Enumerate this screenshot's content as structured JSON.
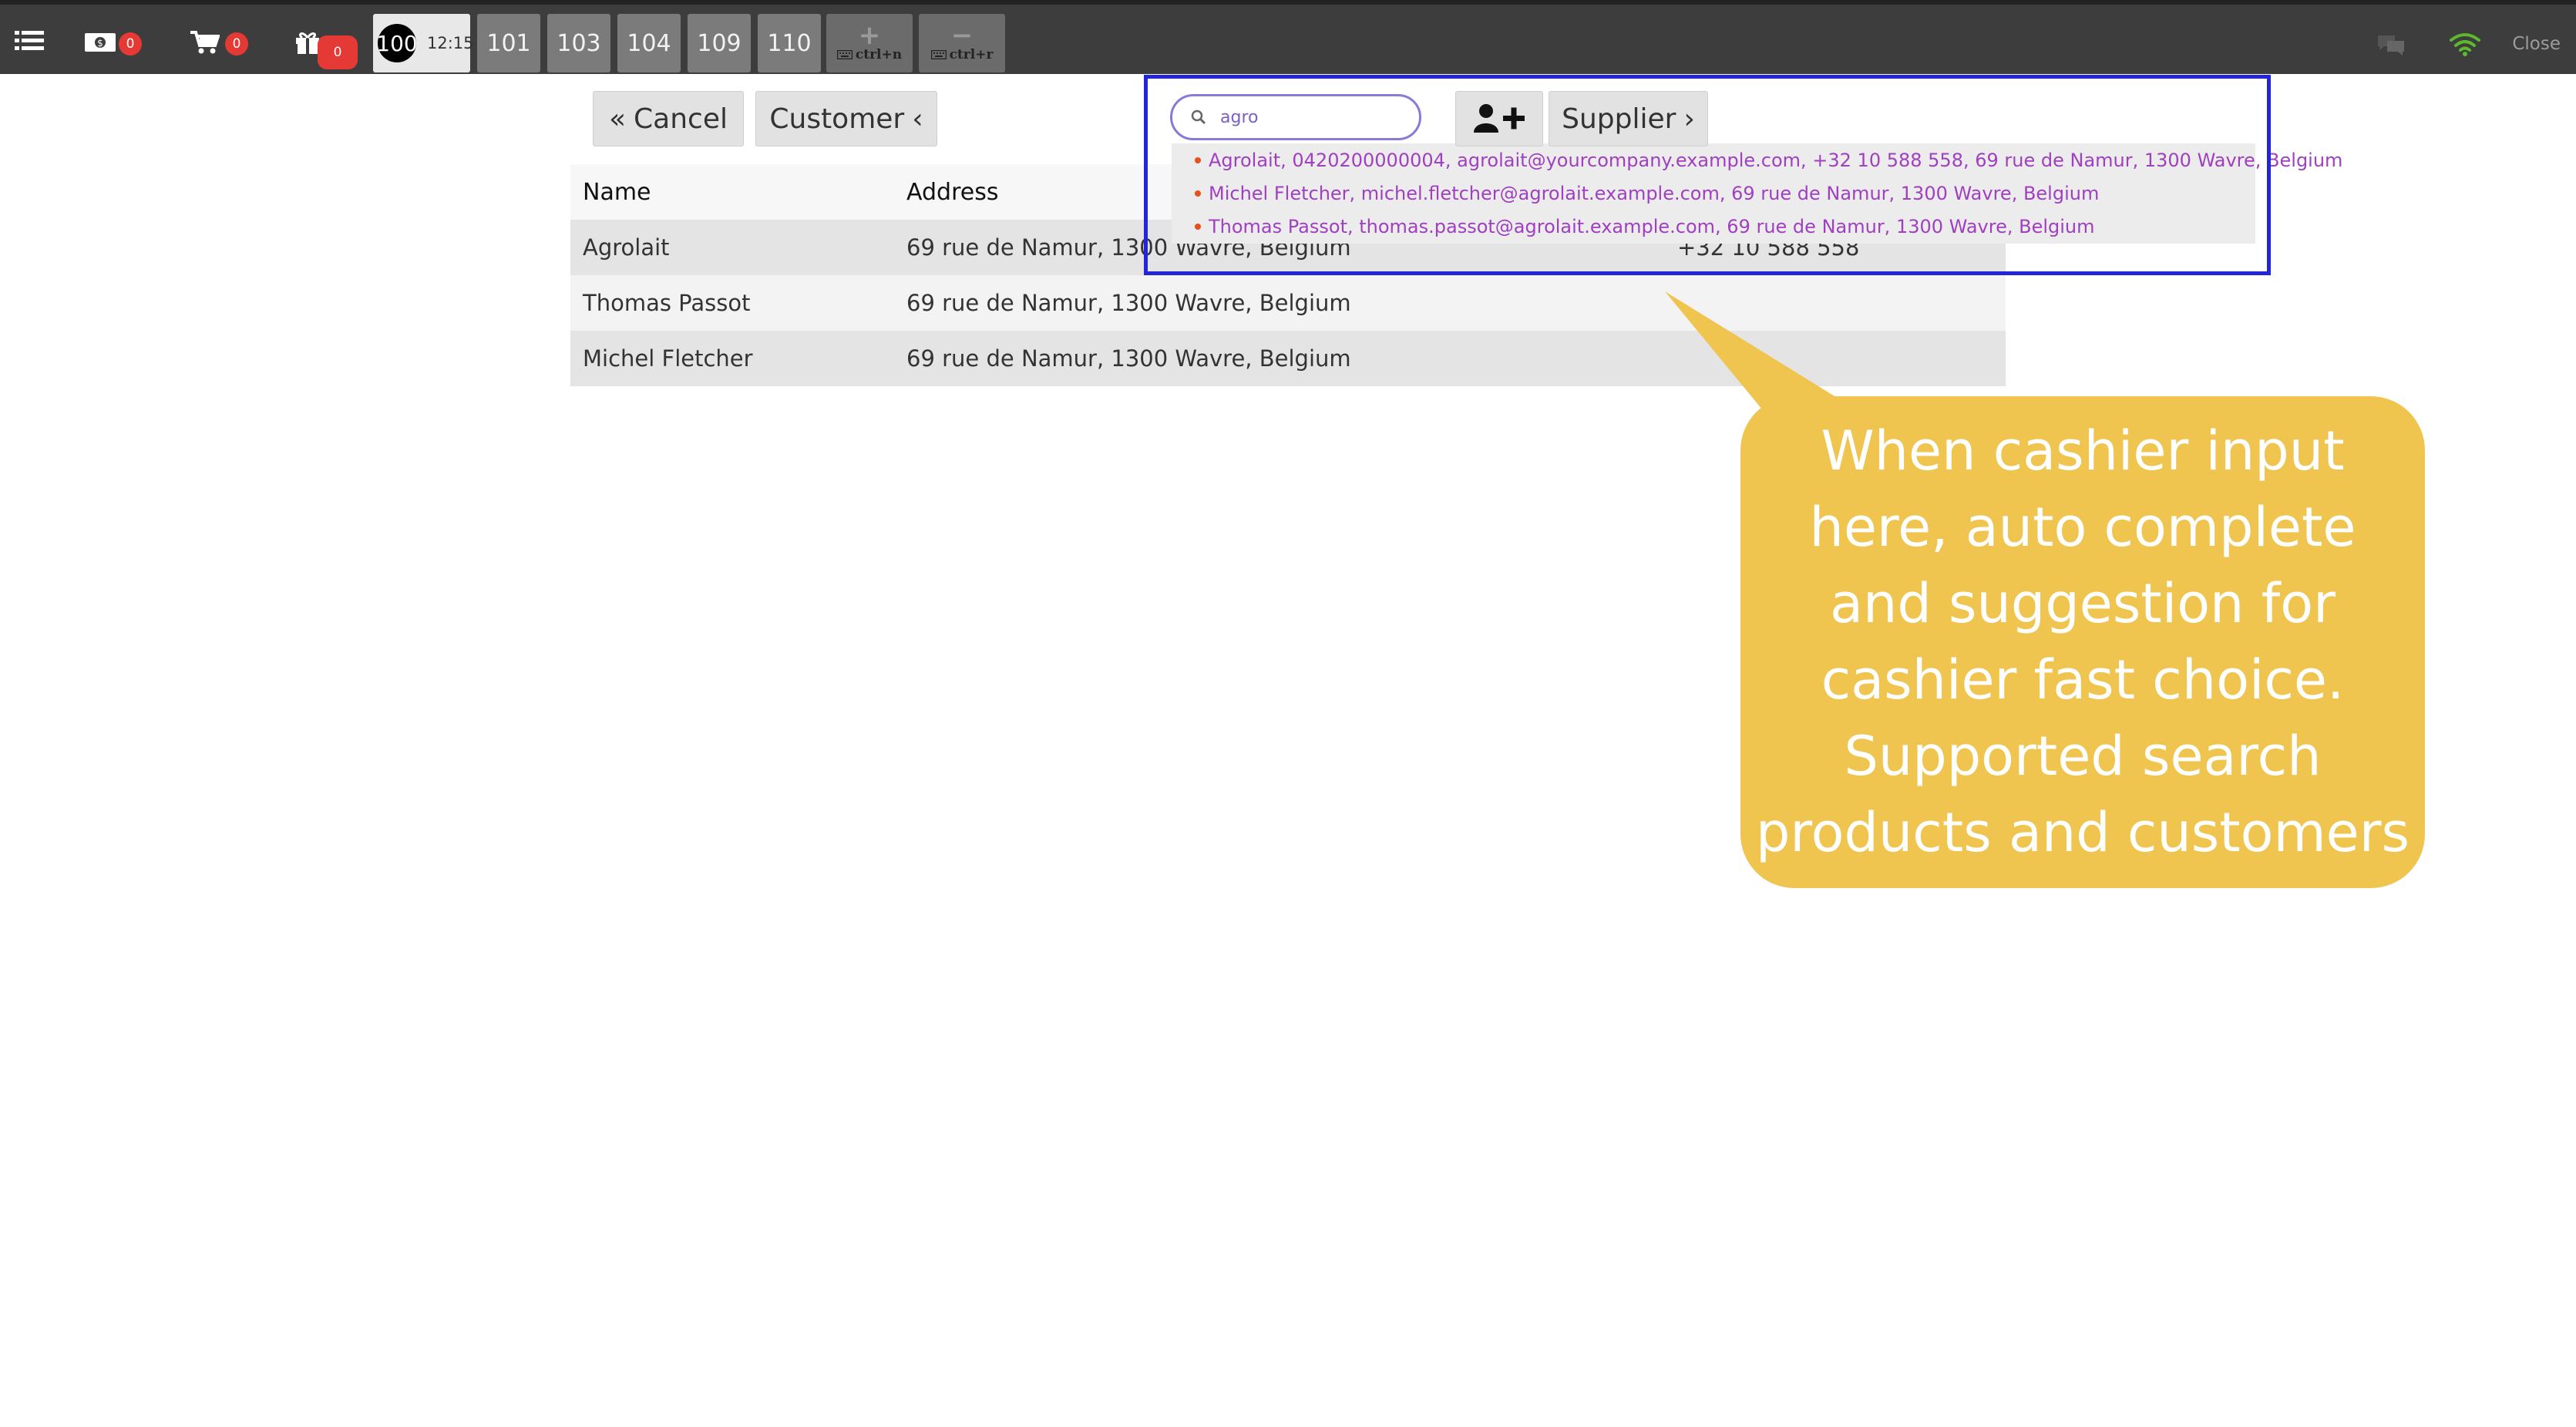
{
  "topbar": {
    "cash_badge": "0",
    "cart_badge": "0",
    "gift_badge": "0",
    "orders": [
      {
        "number": "100",
        "time": "12:15",
        "active": true
      },
      {
        "number": "101"
      },
      {
        "number": "103"
      },
      {
        "number": "104"
      },
      {
        "number": "109"
      },
      {
        "number": "110"
      }
    ],
    "new_order_hint": "ctrl+n",
    "remove_order_hint": "ctrl+r",
    "close_label": "Close"
  },
  "actions": {
    "cancel_label": "Cancel",
    "customer_label": "Customer",
    "supplier_label": "Supplier"
  },
  "search": {
    "value": "agro",
    "suggestions": [
      "Agrolait, 0420200000004, agrolait@yourcompany.example.com, +32 10 588 558, 69 rue de Namur, 1300 Wavre, Belgium",
      "Michel Fletcher, michel.fletcher@agrolait.example.com, 69 rue de Namur, 1300 Wavre, Belgium",
      "Thomas Passot, thomas.passot@agrolait.example.com, 69 rue de Namur, 1300 Wavre, Belgium"
    ]
  },
  "table": {
    "headers": {
      "name": "Name",
      "address": "Address"
    },
    "rows": [
      {
        "name": "Agrolait",
        "address": "69 rue de Namur, 1300 Wavre, Belgium",
        "phone": "+32 10 588 558"
      },
      {
        "name": "Thomas Passot",
        "address": "69 rue de Namur, 1300 Wavre, Belgium",
        "phone": ""
      },
      {
        "name": "Michel Fletcher",
        "address": "69 rue de Namur, 1300 Wavre, Belgium",
        "phone": ""
      }
    ]
  },
  "callout": {
    "text": "When cashier input here, auto complete and suggestion for cashier fast choice. Supported search products and customers"
  },
  "colors": {
    "topbar": "#3d3d3d",
    "badge": "#e53935",
    "wifi": "#5cb82c",
    "highlight_frame": "#2424d8",
    "suggestion_text": "#a040c0",
    "callout": "#efc44f"
  },
  "icons": [
    "menu-list-icon",
    "cash-register-icon",
    "cart-icon",
    "gift-icon",
    "plus-icon",
    "minus-icon",
    "keyboard-icon",
    "chat-icon",
    "wifi-icon",
    "search-icon",
    "user-plus-icon",
    "double-chevron-left-icon",
    "chevron-left-icon",
    "chevron-right-icon"
  ]
}
